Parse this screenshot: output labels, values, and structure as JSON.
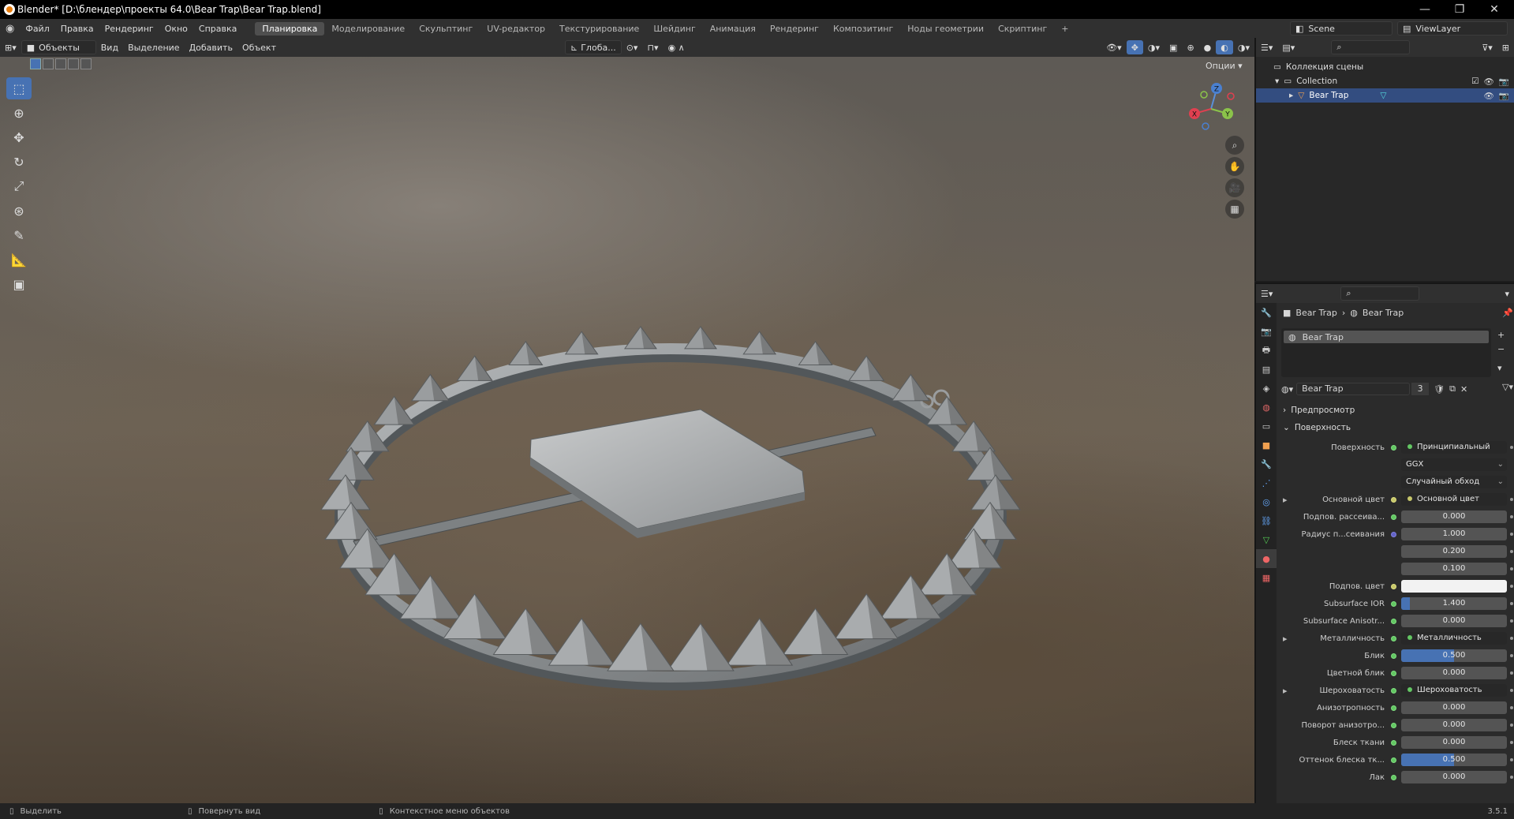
{
  "window": {
    "title": "Blender* [D:\\блендер\\проекты 64.0\\Bear Trap\\Bear Trap.blend]",
    "min": "—",
    "max": "❐",
    "close": "✕"
  },
  "menu": [
    "Файл",
    "Правка",
    "Рендеринг",
    "Окно",
    "Справка"
  ],
  "workspaces": [
    "Планировка",
    "Моделирование",
    "Скульптинг",
    "UV-редактор",
    "Текстурирование",
    "Шейдинг",
    "Анимация",
    "Рендеринг",
    "Композитинг",
    "Ноды геометрии",
    "Скриптинг"
  ],
  "workspace_add": "+",
  "scene": "Scene",
  "view_layer": "ViewLayer",
  "viewport_header": {
    "mode": "Объекты",
    "menus": [
      "Вид",
      "Выделение",
      "Добавить",
      "Объект"
    ],
    "transform": "Глоба...",
    "options": "Опции"
  },
  "gizmo": {
    "z": "Z",
    "y": "Y",
    "x": "X"
  },
  "outliner": {
    "root": "Коллекция сцены",
    "collection": "Collection",
    "object": "Bear Trap"
  },
  "properties": {
    "breadcrumb_obj": "Bear Trap",
    "breadcrumb_mat": "Bear Trap",
    "slot": "Bear Trap",
    "material": "Bear Trap",
    "users": "3",
    "preview": "Предпросмотр",
    "surface_panel": "Поверхность",
    "rows": [
      {
        "label": "Поверхность",
        "type": "link",
        "value": "Принципиальный BSDF",
        "dot": "g"
      },
      {
        "label": "",
        "type": "dropdown",
        "value": "GGX"
      },
      {
        "label": "",
        "type": "dropdown",
        "value": "Случайный обход"
      },
      {
        "label": "Основной цвет",
        "type": "link",
        "value": "Основной цвет",
        "dot": "y",
        "expand": "▸"
      },
      {
        "label": "Подпов. рассеива...",
        "type": "num",
        "value": "0.000",
        "dot": "g"
      },
      {
        "label": "Радиус п...сеивания",
        "type": "num",
        "value": "1.000",
        "dot": "p"
      },
      {
        "label": "",
        "type": "num",
        "value": "0.200"
      },
      {
        "label": "",
        "type": "num",
        "value": "0.100"
      },
      {
        "label": "Подпов. цвет",
        "type": "color",
        "value": "",
        "dot": "y"
      },
      {
        "label": "Subsurface IOR",
        "type": "num",
        "value": "1.400",
        "fill": 0.08,
        "dot": "g"
      },
      {
        "label": "Subsurface Anisotr...",
        "type": "num",
        "value": "0.000",
        "dot": "g"
      },
      {
        "label": "Металличность",
        "type": "link",
        "value": "Металличность",
        "dot": "g",
        "expand": "▸"
      },
      {
        "label": "Блик",
        "type": "num",
        "value": "0.500",
        "fill": 0.5,
        "dot": "g"
      },
      {
        "label": "Цветной блик",
        "type": "num",
        "value": "0.000",
        "dot": "g"
      },
      {
        "label": "Шероховатость",
        "type": "link",
        "value": "Шероховатость",
        "dot": "g",
        "expand": "▸"
      },
      {
        "label": "Анизотропность",
        "type": "num",
        "value": "0.000",
        "dot": "g"
      },
      {
        "label": "Поворот анизотро...",
        "type": "num",
        "value": "0.000",
        "dot": "g"
      },
      {
        "label": "Блеск ткани",
        "type": "num",
        "value": "0.000",
        "dot": "g"
      },
      {
        "label": "Оттенок блеска тк...",
        "type": "num",
        "value": "0.500",
        "fill": 0.5,
        "dot": "g"
      },
      {
        "label": "Лак",
        "type": "num",
        "value": "0.000",
        "dot": "g"
      }
    ]
  },
  "status": {
    "select": "Выделить",
    "rotate": "Повернуть вид",
    "context": "Контекстное меню объектов",
    "version": "3.5.1"
  }
}
